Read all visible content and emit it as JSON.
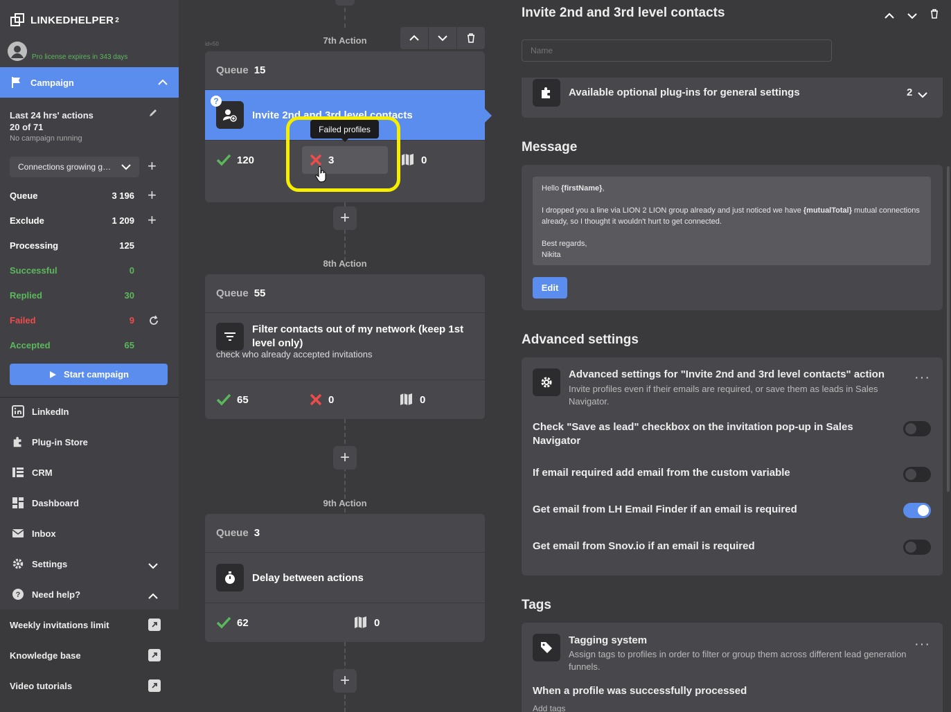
{
  "app": {
    "name": "LINKEDHELPER",
    "sup": "2",
    "license": "Pro license expires in 343 days"
  },
  "campaign": {
    "label": "Campaign",
    "last24_title": "Last 24 hrs' actions",
    "last24_count": "20 of 71",
    "status": "No campaign running",
    "selected": "Connections growing g…",
    "start_label": "Start campaign"
  },
  "stats": [
    {
      "label": "Queue",
      "value": "3 196",
      "color": "#ffffff"
    },
    {
      "label": "Exclude",
      "value": "1 209",
      "color": "#ffffff"
    },
    {
      "label": "Processing",
      "value": "125",
      "color": "#ffffff"
    },
    {
      "label": "Successful",
      "value": "0",
      "color": "#5cb85c"
    },
    {
      "label": "Replied",
      "value": "30",
      "color": "#5cb85c"
    },
    {
      "label": "Failed",
      "value": "9",
      "color": "#ef4b4b"
    },
    {
      "label": "Accepted",
      "value": "65",
      "color": "#5cb85c"
    }
  ],
  "nav": [
    {
      "label": "LinkedIn",
      "icon": "linkedin-icon"
    },
    {
      "label": "Plug-in Store",
      "icon": "puzzle-icon"
    },
    {
      "label": "CRM",
      "icon": "crm-icon"
    },
    {
      "label": "Dashboard",
      "icon": "dashboard-icon"
    },
    {
      "label": "Inbox",
      "icon": "mail-icon"
    },
    {
      "label": "Settings",
      "icon": "gear-icon"
    },
    {
      "label": "Need help?",
      "icon": "help-icon"
    }
  ],
  "help_links": [
    "Weekly invitations limit",
    "Knowledge base",
    "Video tutorials"
  ],
  "actions": {
    "a7": {
      "title": "7th Action",
      "id": "id=50",
      "queue_label": "Queue",
      "queue": "15",
      "name": "Invite 2nd and 3rd level contacts",
      "success": "120",
      "failed": "3",
      "skipped": "0",
      "tooltip": "Failed profiles"
    },
    "a8": {
      "title": "8th Action",
      "queue_label": "Queue",
      "queue": "55",
      "name": "Filter contacts out of my network (keep 1st level only)",
      "desc": "check who already accepted invitations",
      "success": "65",
      "failed": "0",
      "skipped": "0"
    },
    "a9": {
      "title": "9th Action",
      "queue_label": "Queue",
      "queue": "3",
      "name": "Delay between actions",
      "success": "62",
      "skipped": "0"
    }
  },
  "right": {
    "title": "Invite 2nd and 3rd level contacts",
    "name_placeholder": "Name",
    "plugins_label": "Available optional plug-ins for general settings",
    "plugins_count": "2",
    "message_title": "Message",
    "msg": {
      "l1a": "Hello ",
      "l1b": "{firstName}",
      "l1c": ",",
      "l2a": "I dropped you a line via LION 2 LION group already and  just noticed we have ",
      "l2b": "{mutualTotal}",
      "l2c": " mutual connections already, so I thought it wouldn't hurt to get connected.",
      "l3": "Best regards,",
      "l4": "Nikita"
    },
    "edit_label": "Edit",
    "advanced_title": "Advanced settings",
    "adv_head": "Advanced settings for \"Invite 2nd and 3rd level contacts\" action",
    "adv_desc": "Invite profiles even if their emails are required, or save them as leads in Sales Navigator.",
    "options": [
      {
        "label": "Check \"Save as lead\" checkbox on the invitation pop-up in Sales Navigator",
        "on": false
      },
      {
        "label": "If email required add email from the custom variable",
        "on": false
      },
      {
        "label": "Get email from LH Email Finder if an email is required",
        "on": true
      },
      {
        "label": "Get email from Snov.io if an email is required",
        "on": false
      }
    ],
    "tags_title": "Tags",
    "tag_head": "Tagging system",
    "tag_desc": "Assign tags to profiles in order to filter or group them across different lead generation funnels.",
    "tag_when": "When a profile was successfully processed",
    "tag_add": "Add tags"
  },
  "colors": {
    "accent": "#5b8def",
    "success": "#5cb85c",
    "danger": "#ef4b4b",
    "highlight": "#f5ee00"
  }
}
